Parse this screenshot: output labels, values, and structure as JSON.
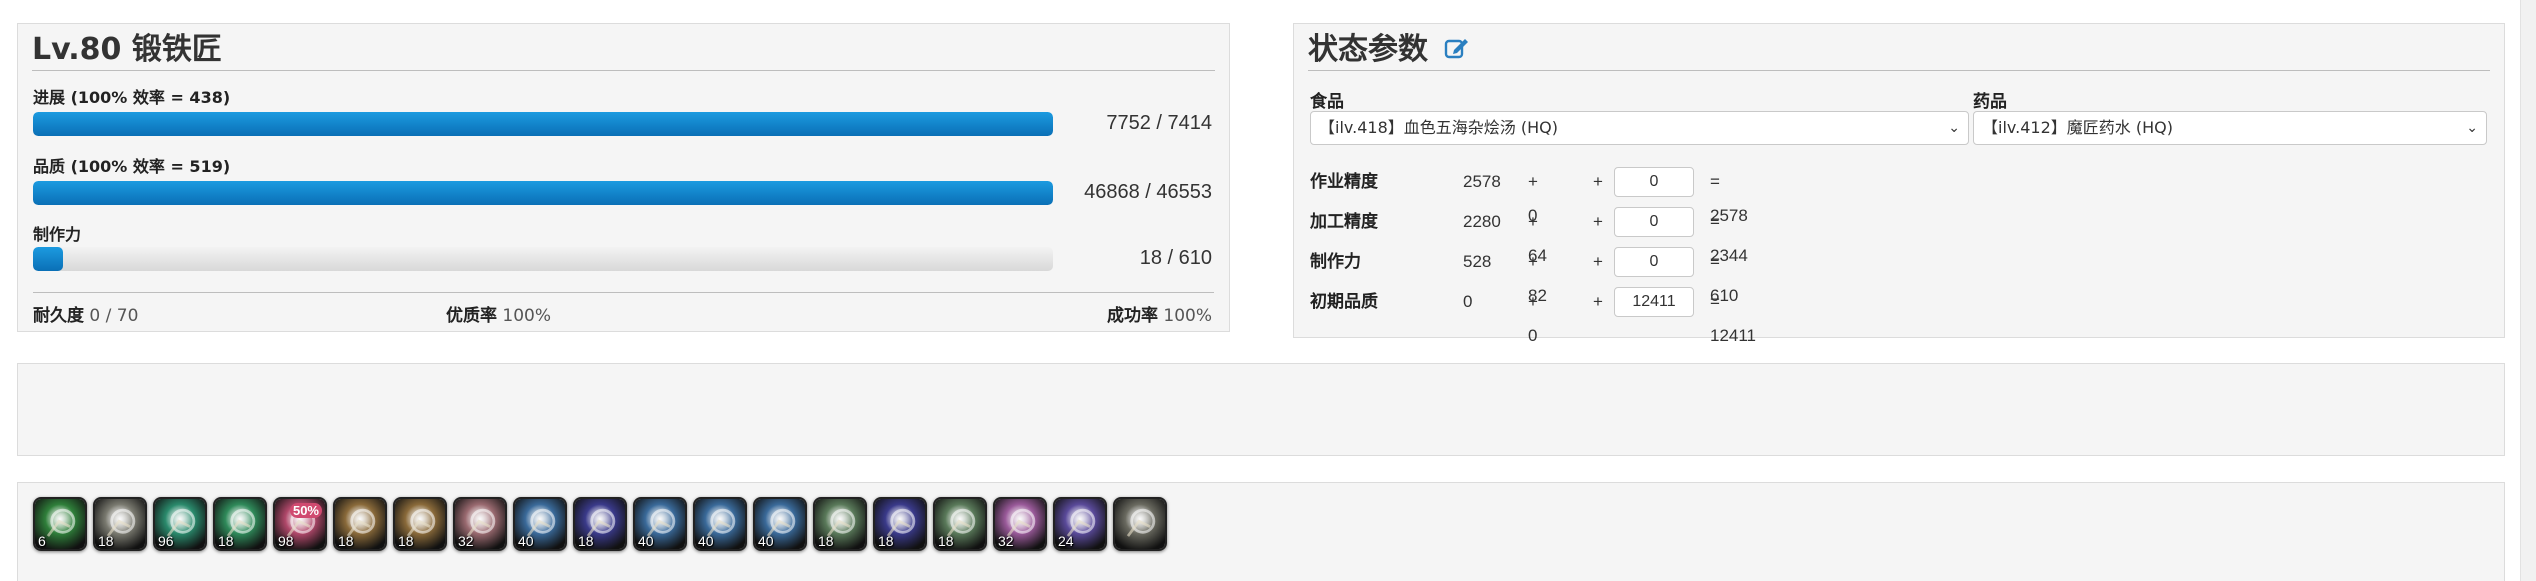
{
  "crafter": {
    "title": "Lv.80 锻铁匠",
    "progress": {
      "label": "进展 (100% 效率 = 438)",
      "value_text": "7752 / 7414",
      "fill": 1.0
    },
    "quality": {
      "label": "品质  (100% 效率 = 519)",
      "value_text": "46868 / 46553",
      "fill": 1.0
    },
    "cp": {
      "label": "制作力",
      "value_text": "18 / 610",
      "fill": 0.0295
    },
    "footer": {
      "durability_label": "耐久度",
      "durability_value": "0 / 70",
      "hq_label": "优质率",
      "hq_value": "100%",
      "success_label": "成功率",
      "success_value": "100%"
    }
  },
  "stats": {
    "title": "状态参数",
    "food": {
      "label": "食品",
      "selected": "【ilv.418】血色五海杂烩汤 (HQ)"
    },
    "medicine": {
      "label": "药品",
      "selected": "【ilv.412】魔匠药水 (HQ)"
    },
    "rows": [
      {
        "name": "作业精度",
        "base": "2578",
        "bonus": "+ 0",
        "plus": "+",
        "input": "0",
        "total": "= 2578"
      },
      {
        "name": "加工精度",
        "base": "2280",
        "bonus": "+ 64",
        "plus": "+",
        "input": "0",
        "total": "= 2344"
      },
      {
        "name": "制作力",
        "base": "528",
        "bonus": "+ 82",
        "plus": "+",
        "input": "0",
        "total": "= 610"
      },
      {
        "name": "初期品质",
        "base": "0",
        "bonus": "+ 0",
        "plus": "+",
        "input": "12411",
        "total": "= 12411"
      }
    ]
  },
  "actions": [
    {
      "icon": "muscle-memory-icon",
      "cost": "6",
      "color": "#2f7f3a"
    },
    {
      "icon": "manipulation-icon",
      "cost": "18",
      "color": "#7a7a70"
    },
    {
      "icon": "veneration-icon",
      "cost": "96",
      "color": "#2a8a6c"
    },
    {
      "icon": "waste-not-icon",
      "cost": "18",
      "color": "#2f8a5a"
    },
    {
      "icon": "groundwork-icon",
      "cost": "98",
      "color": "#b0486a",
      "badge": "50%"
    },
    {
      "icon": "prudent-touch-icon",
      "cost": "18",
      "color": "#8a6a3a"
    },
    {
      "icon": "prudent-touch-icon",
      "cost": "18",
      "color": "#8a6a3a"
    },
    {
      "icon": "preparatory-touch-icon",
      "cost": "32",
      "color": "#9a6a70"
    },
    {
      "icon": "innovation-icon",
      "cost": "40",
      "color": "#3a6a9a"
    },
    {
      "icon": "great-strides-icon",
      "cost": "18",
      "color": "#3a3a8a"
    },
    {
      "icon": "basic-touch-icon",
      "cost": "40",
      "color": "#3a6a9a"
    },
    {
      "icon": "basic-touch-icon",
      "cost": "40",
      "color": "#3a6a9a"
    },
    {
      "icon": "standard-touch-icon",
      "cost": "40",
      "color": "#3a6a9a"
    },
    {
      "icon": "advanced-touch-icon",
      "cost": "18",
      "color": "#5a7a5a"
    },
    {
      "icon": "great-strides-icon",
      "cost": "18",
      "color": "#3a3a8a"
    },
    {
      "icon": "innovation-icon",
      "cost": "18",
      "color": "#5a7a5a"
    },
    {
      "icon": "byregots-blessing-icon",
      "cost": "32",
      "color": "#9a5a9a"
    },
    {
      "icon": "trained-finesse-icon",
      "cost": "24",
      "color": "#5a4a9a"
    },
    {
      "icon": "careful-synthesis-icon",
      "cost": "",
      "color": "#6a6a60"
    }
  ]
}
